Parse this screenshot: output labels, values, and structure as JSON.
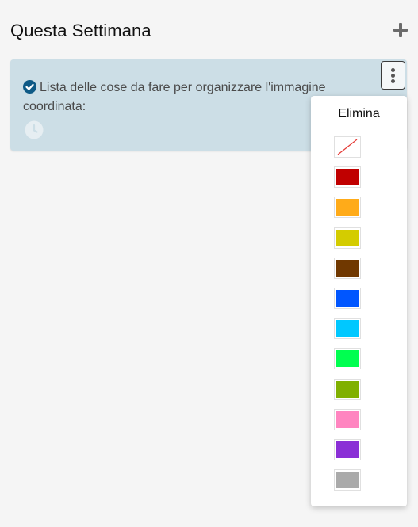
{
  "header": {
    "title": "Questa Settimana"
  },
  "card": {
    "text": "Lista delle cose da fare per organizzare l'immagine coordinata:",
    "background_color": "#ccdee6"
  },
  "dropdown": {
    "title": "Elimina",
    "colors": [
      {
        "name": "none",
        "hex": null
      },
      {
        "name": "red",
        "hex": "#c00000"
      },
      {
        "name": "orange",
        "hex": "#ffab19"
      },
      {
        "name": "yellow",
        "hex": "#d4cc00"
      },
      {
        "name": "brown",
        "hex": "#703800"
      },
      {
        "name": "blue",
        "hex": "#0056ff"
      },
      {
        "name": "cyan",
        "hex": "#00c8ff"
      },
      {
        "name": "green",
        "hex": "#00ff50"
      },
      {
        "name": "olive-green",
        "hex": "#80b000"
      },
      {
        "name": "pink",
        "hex": "#ff85c0"
      },
      {
        "name": "purple",
        "hex": "#8a2fd6"
      },
      {
        "name": "gray",
        "hex": "#aaaaaa"
      }
    ]
  },
  "icons": {
    "add": "plus-icon",
    "done": "check-circle-icon",
    "due": "clock-icon",
    "menu": "kebab-menu-icon"
  }
}
